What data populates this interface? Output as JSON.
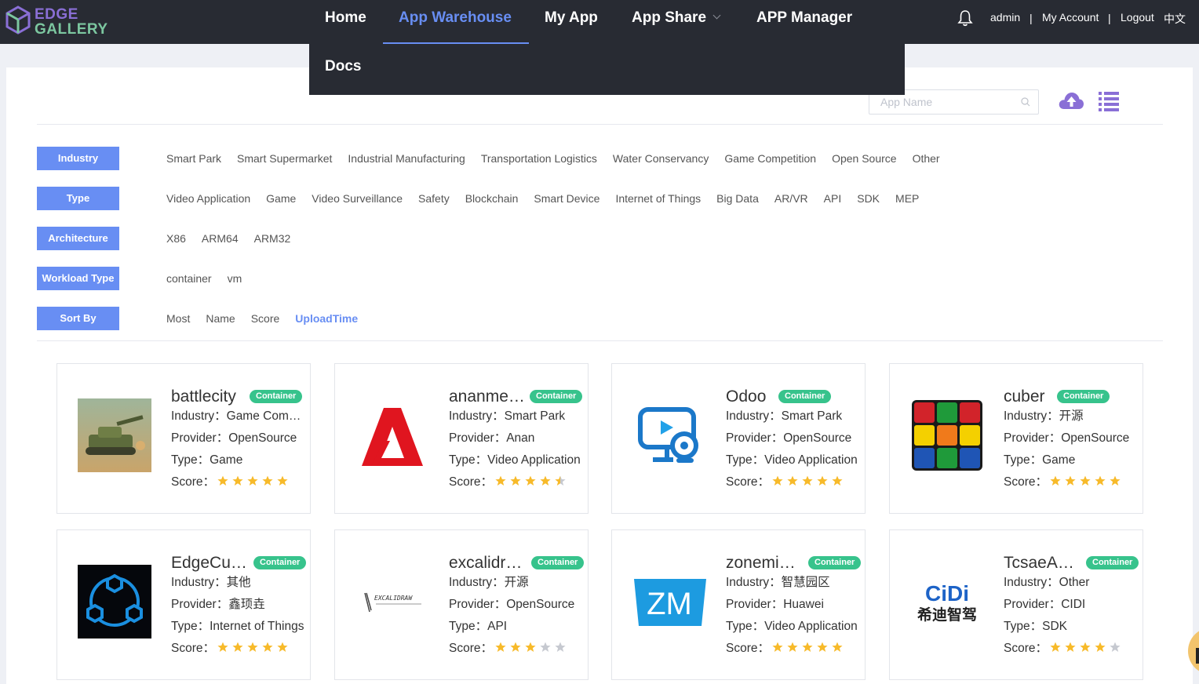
{
  "brand": {
    "line1": "EDGE",
    "line2": "GALLERY"
  },
  "nav": {
    "home": "Home",
    "warehouse": "App Warehouse",
    "myapp": "My App",
    "share": "App Share",
    "manager": "APP Manager",
    "docs": "Docs"
  },
  "user": {
    "name": "admin",
    "account": "My Account",
    "logout": "Logout",
    "lang": "中文",
    "sep": "|"
  },
  "search": {
    "placeholder": "App Name"
  },
  "filters": {
    "industry": {
      "label": "Industry",
      "options": [
        "Smart Park",
        "Smart Supermarket",
        "Industrial Manufacturing",
        "Transportation Logistics",
        "Water Conservancy",
        "Game Competition",
        "Open Source",
        "Other"
      ]
    },
    "type": {
      "label": "Type",
      "options": [
        "Video Application",
        "Game",
        "Video Surveillance",
        "Safety",
        "Blockchain",
        "Smart Device",
        "Internet of Things",
        "Big Data",
        "AR/VR",
        "API",
        "SDK",
        "MEP"
      ]
    },
    "architecture": {
      "label": "Architecture",
      "options": [
        "X86",
        "ARM64",
        "ARM32"
      ]
    },
    "workload": {
      "label": "Workload Type",
      "options": [
        "container",
        "vm"
      ]
    },
    "sort": {
      "label": "Sort By",
      "options": [
        "Most",
        "Name",
        "Score",
        "UploadTime"
      ],
      "active": "UploadTime"
    }
  },
  "colors": {
    "accent": "#688ef3",
    "header": "#282b33",
    "badge": "#37c38c",
    "star": "#f7ba2a"
  },
  "apps": [
    {
      "name": "battlecity",
      "badge": "Container",
      "industry": "Industry：Game Com…",
      "provider": "Provider：OpenSource",
      "type": "Type：Game",
      "score_label": "Score：",
      "score": 5,
      "icon": "tank-game-icon"
    },
    {
      "name": "ananme…",
      "badge": "Container",
      "industry": "Industry：Smart Park",
      "provider": "Provider：Anan",
      "type": "Type：Video Application",
      "score_label": "Score：",
      "score": 4.5,
      "icon": "red-a-logo-icon"
    },
    {
      "name": "Odoo",
      "badge": "Container",
      "industry": "Industry：Smart Park",
      "provider": "Provider：OpenSource",
      "type": "Type：Video Application",
      "score_label": "Score：",
      "score": 5,
      "icon": "monitor-camera-icon"
    },
    {
      "name": "cuber",
      "badge": "Container",
      "industry": "Industry：开源",
      "provider": "Provider：OpenSource",
      "type": "Type：Game",
      "score_label": "Score：",
      "score": 5,
      "icon": "rubik-cube-icon"
    },
    {
      "name": "EdgeCu…",
      "badge": "Container",
      "industry": "Industry：其他",
      "provider": "Provider：鑫顼垚",
      "type": "Type：Internet of Things",
      "score_label": "Score：",
      "score": 5,
      "icon": "network-hexagon-icon"
    },
    {
      "name": "excalidr…",
      "badge": "Container",
      "industry": "Industry：开源",
      "provider": "Provider：OpenSource",
      "type": "Type：API",
      "score_label": "Score：",
      "score": 3,
      "icon": "excalidraw-logo-icon",
      "icon_text": "EXCALIDRAW"
    },
    {
      "name": "zonemi…",
      "badge": "Container",
      "industry": "Industry：智慧园区",
      "provider": "Provider：Huawei",
      "type": "Type：Video Application",
      "score_label": "Score：",
      "score": 5,
      "icon": "zm-logo-icon",
      "icon_text": "ZM"
    },
    {
      "name": "TcsaeA…",
      "badge": "Container",
      "industry": "Industry：Other",
      "provider": "Provider：CIDI",
      "type": "Type：SDK",
      "score_label": "Score：",
      "score": 4,
      "icon": "cidi-logo-icon",
      "icon_text": "CiDi",
      "icon_text2": "希迪智驾"
    }
  ]
}
